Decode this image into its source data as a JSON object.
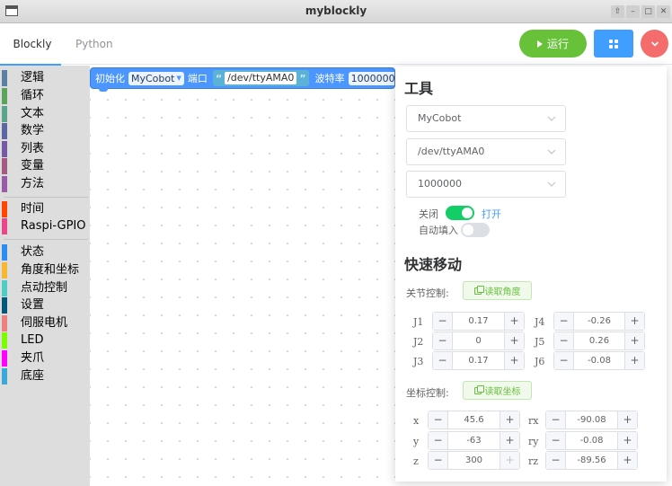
{
  "window": {
    "title": "myblockly",
    "controls": [
      "⇧",
      "–",
      "□",
      "✕"
    ]
  },
  "header": {
    "tabs": [
      {
        "label": "Blockly",
        "active": true
      },
      {
        "label": "Python",
        "active": false
      }
    ],
    "run_label": "运行",
    "accent": "#409eff"
  },
  "toolbox": {
    "items": [
      {
        "label": "逻辑",
        "color": "#5b80a5"
      },
      {
        "label": "循环",
        "color": "#5ba55b"
      },
      {
        "label": "文本",
        "color": "#5ba58c"
      },
      {
        "label": "数学",
        "color": "#5b67a5"
      },
      {
        "label": "列表",
        "color": "#745ba5"
      },
      {
        "label": "变量",
        "color": "#a55b80"
      },
      {
        "label": "方法",
        "color": "#995ba5"
      },
      {
        "label": "时间",
        "color": "#ff4500"
      },
      {
        "label": "Raspi-GPIO",
        "color": "#e8488a"
      },
      {
        "label": "状态",
        "color": "#2d8cf0"
      },
      {
        "label": "角度和坐标",
        "color": "#f7b733"
      },
      {
        "label": "点动控制",
        "color": "#4ecdc4"
      },
      {
        "label": "设置",
        "color": "#00587a"
      },
      {
        "label": "伺服电机",
        "color": "#f08080"
      },
      {
        "label": "LED",
        "color": "#7cfc00"
      },
      {
        "label": "夹爪",
        "color": "#ff00ff"
      },
      {
        "label": "底座",
        "color": "#3aa8d8"
      }
    ]
  },
  "block": {
    "label_init": "初始化",
    "robot": "MyCobot",
    "label_port": "端口",
    "port": "/dev/ttyAMA0",
    "label_baud": "波特率",
    "baud": "1000000",
    "quote_open": "“",
    "quote_close": "”"
  },
  "tools": {
    "title": "工具",
    "robot_select": "MyCobot",
    "port_select": "/dev/ttyAMA0",
    "baud_select": "1000000",
    "close_label": "关闭",
    "open_label": "打开",
    "autofill_label": "自动填入",
    "power_on": true,
    "autofill_on": false
  },
  "quick_move": {
    "title": "快速移动",
    "joint_label": "关节控制:",
    "read_angles": "读取角度",
    "coord_label": "坐标控制:",
    "read_coords": "读取坐标",
    "joints": [
      {
        "name": "J1",
        "value": "0.17"
      },
      {
        "name": "J2",
        "value": "0"
      },
      {
        "name": "J3",
        "value": "0.17"
      },
      {
        "name": "J4",
        "value": "-0.26"
      },
      {
        "name": "J5",
        "value": "0.26"
      },
      {
        "name": "J6",
        "value": "-0.08"
      }
    ],
    "coords": [
      {
        "name": "x",
        "value": "45.6"
      },
      {
        "name": "y",
        "value": "-63"
      },
      {
        "name": "z",
        "value": "300"
      },
      {
        "name": "rx",
        "value": "-90.08"
      },
      {
        "name": "ry",
        "value": "-0.08"
      },
      {
        "name": "rz",
        "value": "-89.56"
      }
    ],
    "minus": "−",
    "plus": "+"
  }
}
